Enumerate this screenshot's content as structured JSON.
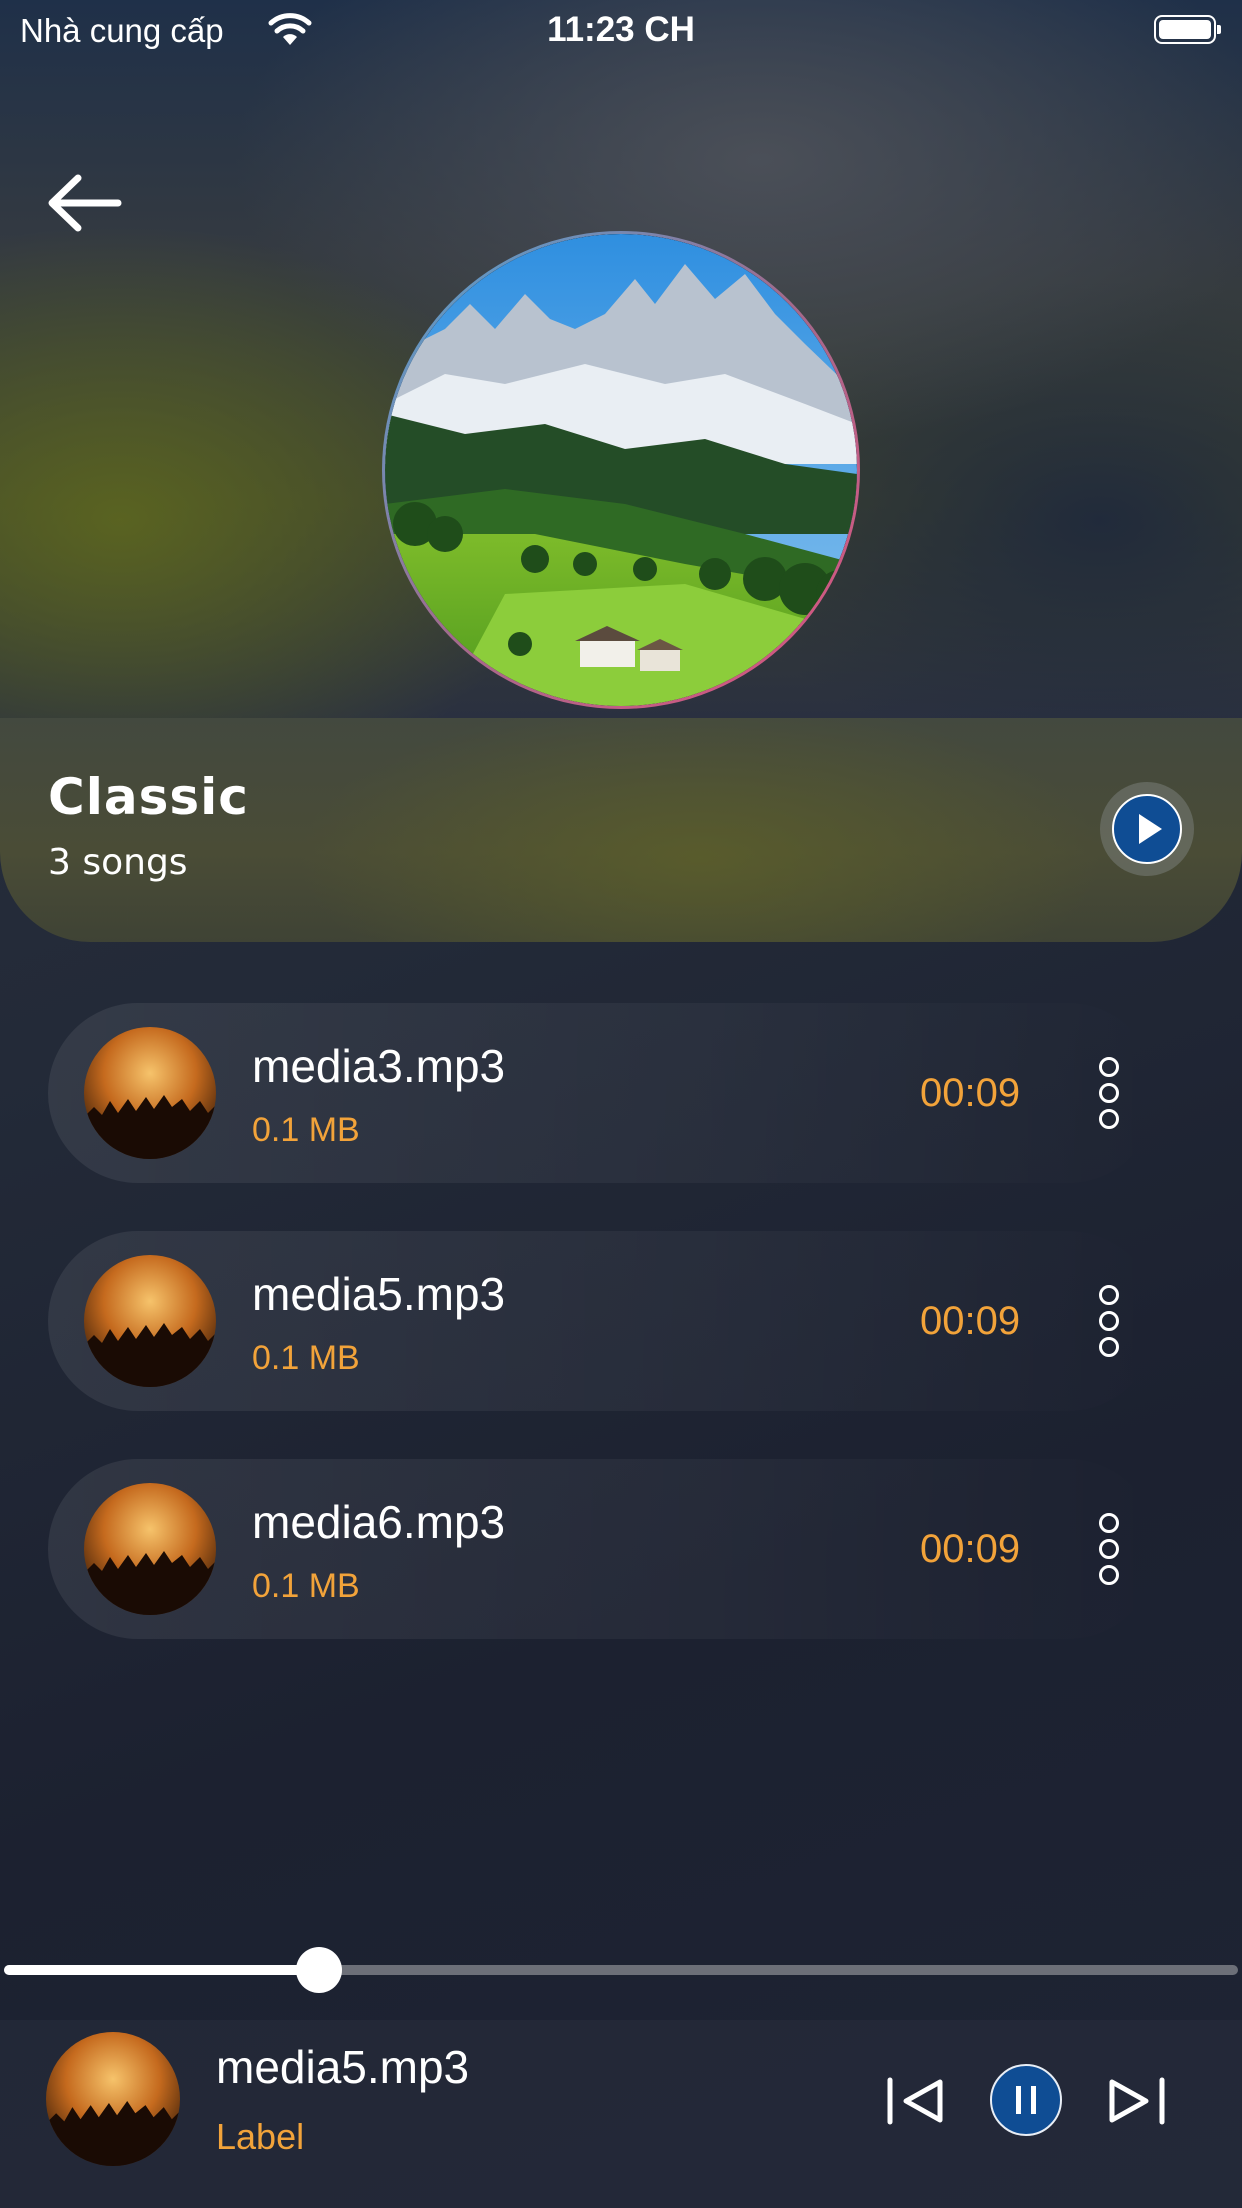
{
  "status_bar": {
    "carrier": "Nhà cung cấp",
    "time": "11:23 CH",
    "icons": [
      "wifi-icon",
      "battery-icon"
    ]
  },
  "header": {
    "back_icon": "arrow-left-icon"
  },
  "album": {
    "title": "Classic",
    "song_count": "3 songs",
    "cover": "mountain-landscape",
    "play_icon": "play-icon"
  },
  "songs": [
    {
      "title": "media3.mp3",
      "size": "0.1 MB",
      "duration": "00:09",
      "more_icon": "more-vertical-icon"
    },
    {
      "title": "media5.mp3",
      "size": "0.1 MB",
      "duration": "00:09",
      "more_icon": "more-vertical-icon"
    },
    {
      "title": "media6.mp3",
      "size": "0.1 MB",
      "duration": "00:09",
      "more_icon": "more-vertical-icon"
    }
  ],
  "player": {
    "title": "media5.mp3",
    "subtitle": "Label",
    "progress": 0.255,
    "controls": [
      "skip-previous-icon",
      "pause-icon",
      "skip-next-icon"
    ]
  },
  "colors": {
    "accent": "#f2a33a",
    "primary_button": "#0f4d94",
    "text": "#ffffff"
  }
}
